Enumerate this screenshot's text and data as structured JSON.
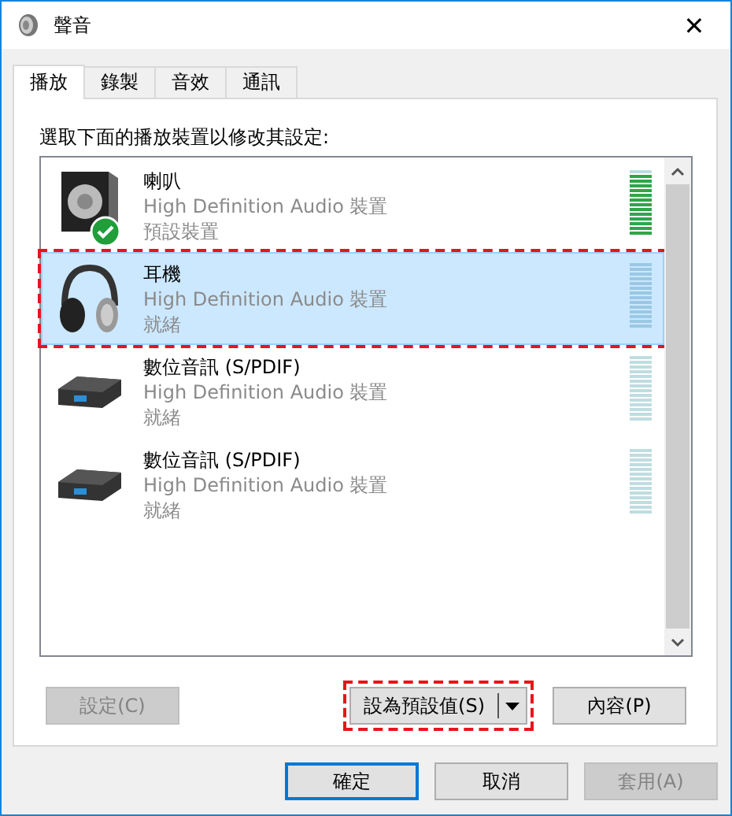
{
  "window": {
    "title": "聲音",
    "close": "✕"
  },
  "tabs": [
    {
      "label": "播放",
      "selected": true
    },
    {
      "label": "錄製",
      "selected": false
    },
    {
      "label": "音效",
      "selected": false
    },
    {
      "label": "通訊",
      "selected": false
    }
  ],
  "instruction": "選取下面的播放裝置以修改其設定:",
  "devices": [
    {
      "kind": "speaker",
      "name": "喇叭",
      "driver": "High Definition Audio 裝置",
      "status": "預設裝置",
      "default": true,
      "selected": false,
      "annotated": false,
      "level": 0.93
    },
    {
      "kind": "headphones",
      "name": "耳機",
      "driver": "High Definition Audio 裝置",
      "status": "就緒",
      "default": false,
      "selected": true,
      "annotated": true,
      "level": 0
    },
    {
      "kind": "digital",
      "name": "數位音訊 (S/PDIF)",
      "driver": "High Definition Audio 裝置",
      "status": "就緒",
      "default": false,
      "selected": false,
      "annotated": false,
      "level": 0
    },
    {
      "kind": "digital",
      "name": "數位音訊 (S/PDIF)",
      "driver": "High Definition Audio 裝置",
      "status": "就緒",
      "default": false,
      "selected": false,
      "annotated": false,
      "level": 0
    }
  ],
  "panel_buttons": [
    {
      "label": "設定(C)",
      "disabled": true,
      "split": false,
      "annotated": false
    },
    {
      "label": "設為預設值(S)",
      "disabled": false,
      "split": true,
      "annotated": true
    },
    {
      "label": "內容(P)",
      "disabled": false,
      "split": false,
      "annotated": false
    }
  ],
  "dialog_buttons": [
    {
      "label": "確定",
      "disabled": false,
      "default": true
    },
    {
      "label": "取消",
      "disabled": false,
      "default": false
    },
    {
      "label": "套用(A)",
      "disabled": true,
      "default": false
    }
  ]
}
